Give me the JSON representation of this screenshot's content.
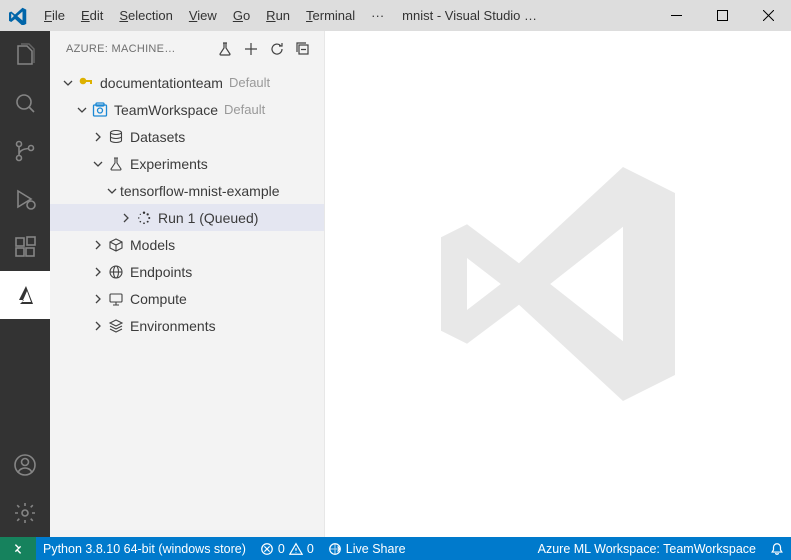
{
  "titlebar": {
    "menu": {
      "file": "File",
      "edit": "Edit",
      "selection": "Selection",
      "view": "View",
      "go": "Go",
      "run": "Run",
      "terminal": "Terminal",
      "more": "···"
    },
    "title": "mnist - Visual Studio …"
  },
  "sidebar": {
    "header": {
      "title": "AZURE: MACHINE…"
    },
    "tree": {
      "subscription": {
        "label": "documentationteam",
        "desc": "Default"
      },
      "workspace": {
        "label": "TeamWorkspace",
        "desc": "Default"
      },
      "datasets": "Datasets",
      "experiments": "Experiments",
      "exp1": "tensorflow-mnist-example",
      "run1": "Run 1 (Queued)",
      "models": "Models",
      "endpoints": "Endpoints",
      "compute": "Compute",
      "environments": "Environments"
    }
  },
  "statusbar": {
    "python": "Python 3.8.10 64-bit (windows store)",
    "errors": "0",
    "warnings": "0",
    "liveshare": "Live Share",
    "workspace": "Azure ML Workspace: TeamWorkspace"
  }
}
